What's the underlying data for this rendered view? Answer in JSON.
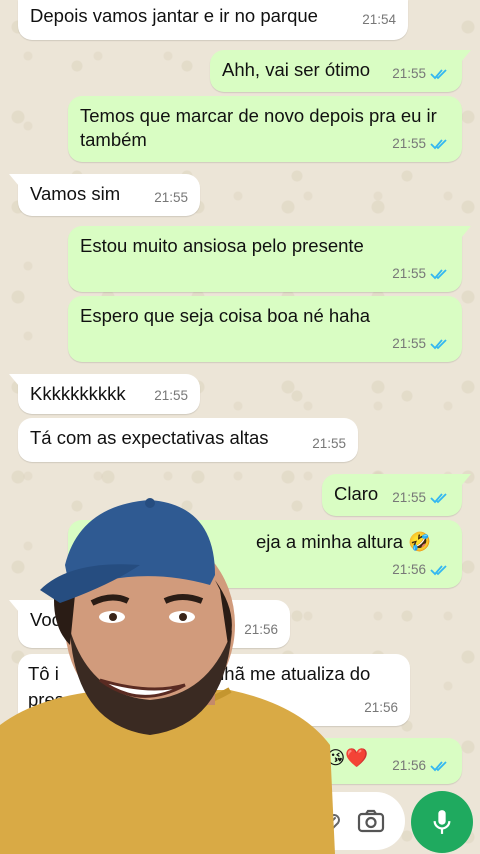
{
  "messages": [
    {
      "text": "Depois vamos jantar e ir no parque",
      "time": "21:54"
    },
    {
      "text": "Ahh, vai ser ótimo",
      "time": "21:55"
    },
    {
      "text": "Temos que marcar de novo depois pra eu ir também",
      "time": "21:55"
    },
    {
      "text": "Vamos sim",
      "time": "21:55"
    },
    {
      "text": "Estou muito ansiosa pelo presente",
      "time": "21:55"
    },
    {
      "text": "Espero que seja coisa boa né haha",
      "time": "21:55"
    },
    {
      "text": "Kkkkkkkkkk",
      "time": "21:55"
    },
    {
      "text": "Tá com as expectativas altas",
      "time": "21:55"
    },
    {
      "text": "Claro",
      "time": "21:55"
    },
    {
      "text": "eja a minha altura 🤣",
      "time": "21:56"
    },
    {
      "text": "Voc",
      "time": "21:56"
    },
    {
      "text": "Tô i",
      "text2": "nhã me atualiza do",
      "text3": "prese",
      "time": "21:56"
    },
    {
      "text": "😘❤️",
      "time": "21:56"
    }
  ],
  "colors": {
    "outgoing_bubble": "#d9fdc3",
    "incoming_bubble": "#ffffff",
    "read_ticks": "#34b7f1",
    "mic_button": "#1faa5f"
  },
  "icons": [
    "double-check-icon",
    "camera-icon",
    "attach-icon",
    "mic-icon"
  ]
}
